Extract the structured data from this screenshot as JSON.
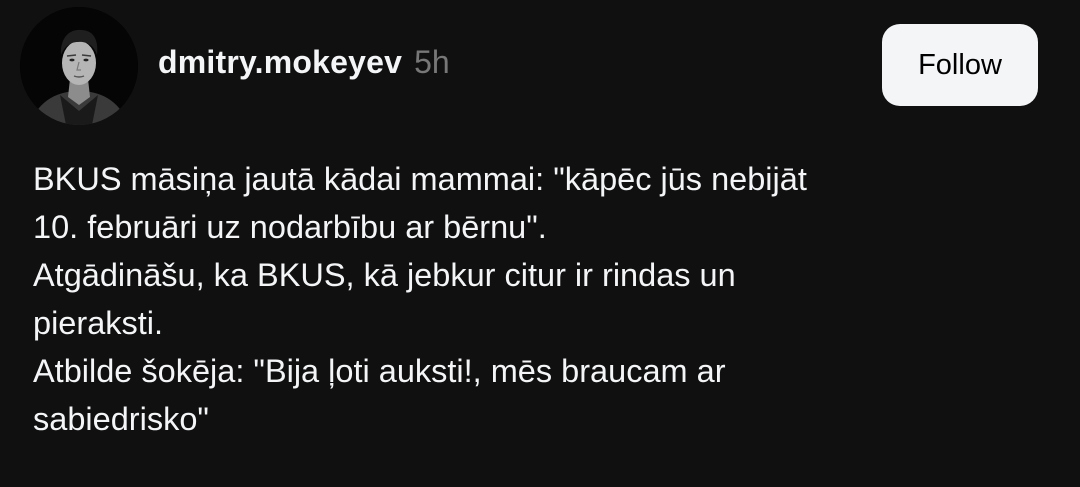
{
  "post": {
    "author": {
      "username": "dmitry.mokeyev",
      "timestamp": "5h",
      "avatar_icon": "profile-photo"
    },
    "follow_label": "Follow",
    "lines": [
      "BKUS māsiņa jautā kādai mammai: \"kāpēc jūs nebijāt",
      "10. februāri uz nodarbību ar bērnu\".",
      "Atgādināšu, ka BKUS, kā jebkur citur ir rindas un",
      "pieraksti.",
      "Atbilde šokēja: \"Bija ļoti auksti!, mēs braucam ar",
      "sabiedrisko\""
    ]
  },
  "colors": {
    "background": "#101010",
    "text_primary": "#f3f5f7",
    "text_secondary": "#777777",
    "button_bg": "#f3f5f7",
    "button_text": "#000000"
  }
}
